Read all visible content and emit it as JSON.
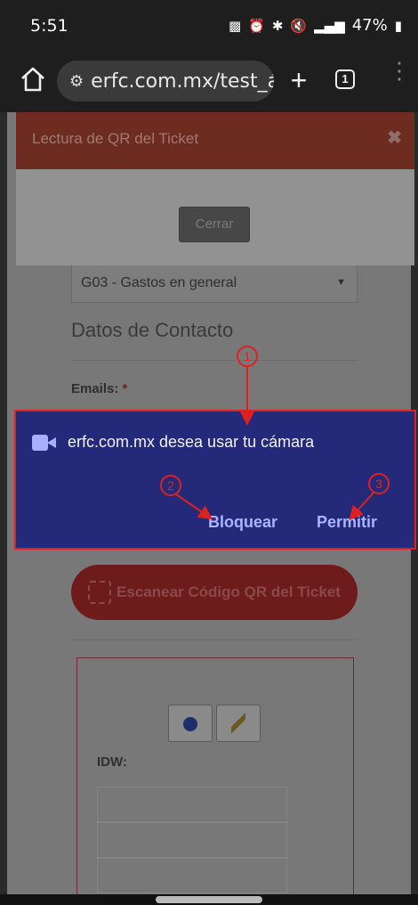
{
  "status": {
    "time": "5:51",
    "battery": "47%"
  },
  "browser": {
    "url": "erfc.com.mx/test_á",
    "tab_count": "1"
  },
  "qr_modal": {
    "title": "Lectura de QR del Ticket",
    "close_symbol": "✖",
    "close_button": "Cerrar"
  },
  "page": {
    "select_value": "G03 - Gastos en general",
    "section_heading": "Datos de Contacto",
    "emails_label": "Emails:",
    "required_mark": "*",
    "scan_button": "Escanear Código QR del Ticket",
    "idw_label": "IDW:"
  },
  "permission_dialog": {
    "message": "erfc.com.mx desea usar tu cámara",
    "block_button": "Bloquear",
    "allow_button": "Permitir"
  },
  "annotations": {
    "marker_1": "1",
    "marker_2": "2",
    "marker_3": "3"
  },
  "colors": {
    "dialog_bg": "#24297a",
    "dialog_button": "#a9b5ff",
    "annotation_red": "#e02020",
    "modal_header": "#6e2b1f"
  }
}
